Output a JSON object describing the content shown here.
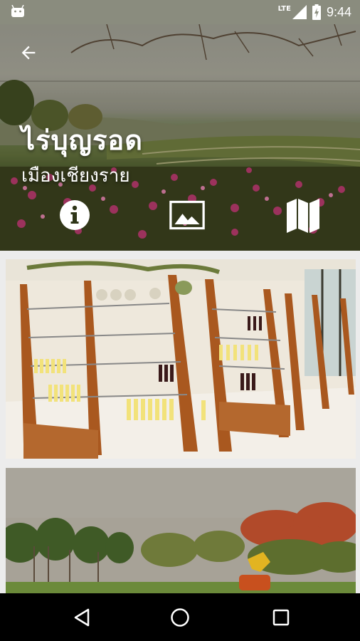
{
  "status_bar": {
    "network_label": "LTE",
    "time": "9:44"
  },
  "header": {
    "title": "ไร่บุญรอด",
    "subtitle": "เมืองเชียงราย"
  },
  "actions": [
    {
      "icon": "info-icon"
    },
    {
      "icon": "gallery-icon"
    },
    {
      "icon": "map-icon"
    }
  ],
  "gallery": [
    {
      "scene": "shop-interior-wooden-shelves"
    },
    {
      "scene": "garden-trees-golden-statue"
    }
  ],
  "colors": {
    "status_bar_bg": "#8a8c7e",
    "nav_bar_bg": "#000000",
    "page_bg": "#ececec"
  }
}
